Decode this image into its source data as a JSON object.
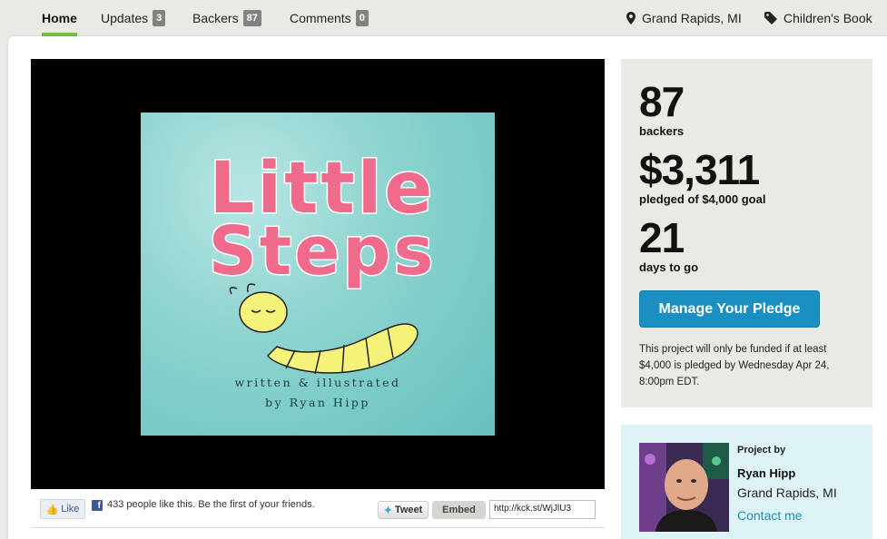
{
  "nav": {
    "tabs": [
      {
        "label": "Home",
        "count": null
      },
      {
        "label": "Updates",
        "count": "3"
      },
      {
        "label": "Backers",
        "count": "87"
      },
      {
        "label": "Comments",
        "count": "0"
      }
    ],
    "location": "Grand Rapids, MI",
    "category": "Children's Book",
    "accent": "#75c043"
  },
  "video": {
    "cover_title_line1": "Little",
    "cover_title_line2": "Steps",
    "cover_sub_line1": "written & illustrated",
    "cover_sub_line2": "by Ryan Hipp"
  },
  "share": {
    "like_label": "Like",
    "like_text": "433 people like this. Be the first of your friends.",
    "tweet_label": "Tweet",
    "embed_label": "Embed",
    "short_url": "http://kck.st/WjJlU3"
  },
  "stats": {
    "backers": "87",
    "backers_label": "backers",
    "pledged": "$3,311",
    "pledged_label": "pledged of $4,000 goal",
    "days": "21",
    "days_label": "days to go",
    "button_label": "Manage Your Pledge",
    "button_color": "#1b8fc1",
    "note": "This project will only be funded if at least $4,000 is pledged by Wednesday Apr 24, 8:00pm EDT."
  },
  "creator": {
    "heading": "Project by",
    "name": "Ryan Hipp",
    "location": "Grand Rapids, MI",
    "contact": "Contact me"
  }
}
